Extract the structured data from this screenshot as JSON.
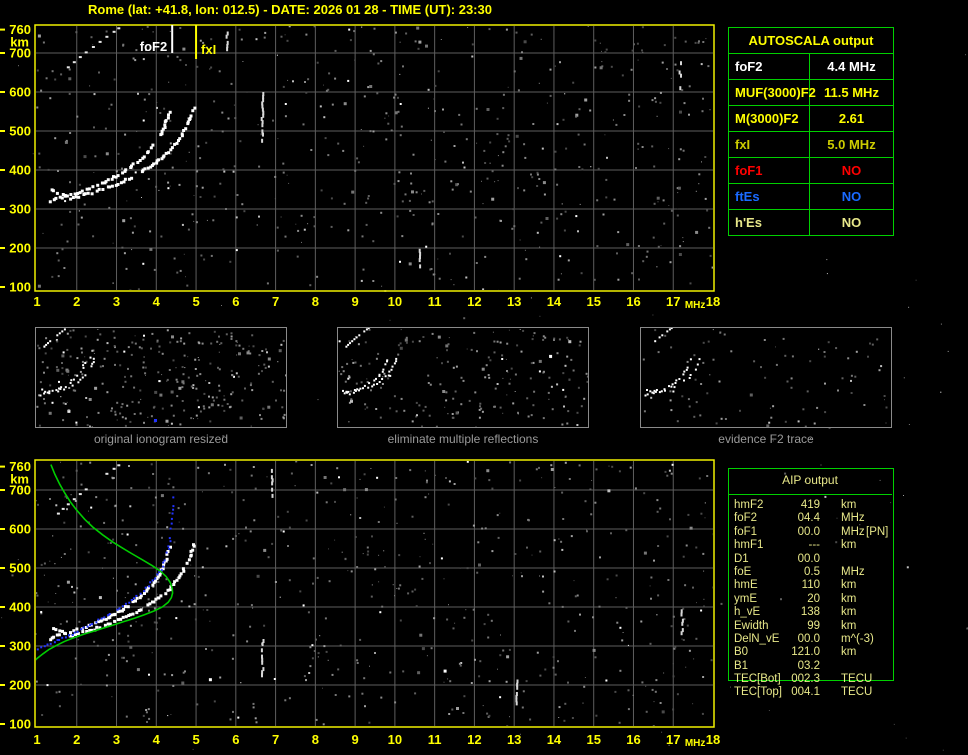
{
  "title": "Rome (lat: +41.8, lon: 012.5) - DATE: 2026 01 28 - TIME (UT): 23:30",
  "colors": {
    "axis_yellow": "#ffff00",
    "border_yellow": "#f0f000",
    "grid_gray": "#5e5e5e",
    "table_green": "#00d000",
    "khaki": "#e8e88a",
    "red": "#ff0000",
    "blue": "#1a6aff",
    "olive": "#cccc00",
    "white": "#ffffff",
    "caption_gray": "#9a9a9a",
    "trace_blue": "#2233ff",
    "profile_green": "#00cc00"
  },
  "autoscala_table": {
    "title": "AUTOSCALA output",
    "rows": [
      {
        "label": "foF2",
        "value": "4.4 MHz",
        "color": "#ffffff"
      },
      {
        "label": "MUF(3000)F2",
        "value": "11.5 MHz",
        "color": "#ffff00"
      },
      {
        "label": "M(3000)F2",
        "value": "2.61",
        "color": "#ffff00"
      },
      {
        "label": "fxI",
        "value": "5.0 MHz",
        "color": "#cccc00"
      },
      {
        "label": "foF1",
        "value": "NO",
        "color": "#ff0000"
      },
      {
        "label": "ftEs",
        "value": "NO",
        "color": "#1a6aff"
      },
      {
        "label": "h'Es",
        "value": "NO",
        "color": "#e8e88a"
      }
    ]
  },
  "aip_table": {
    "title": "AIP output",
    "rows": [
      {
        "label": "hmF2",
        "value": "419",
        "unit": "km",
        "note": ""
      },
      {
        "label": "foF2",
        "value": "04.4",
        "unit": "MHz",
        "note": ""
      },
      {
        "label": "foF1",
        "value": "00.0",
        "unit": "MHz",
        "note": "[PN]"
      },
      {
        "label": "hmF1",
        "value": "---",
        "unit": "km",
        "note": ""
      },
      {
        "label": "D1",
        "value": "00.0",
        "unit": "",
        "note": ""
      },
      {
        "label": "foE",
        "value": "0.5",
        "unit": "MHz",
        "note": ""
      },
      {
        "label": "hmE",
        "value": "110",
        "unit": "km",
        "note": ""
      },
      {
        "label": "ymE",
        "value": "20",
        "unit": "km",
        "note": ""
      },
      {
        "label": "h_vE",
        "value": "138",
        "unit": "km",
        "note": ""
      },
      {
        "label": "Ewidth",
        "value": "99",
        "unit": "km",
        "note": ""
      },
      {
        "label": "DelN_vE",
        "value": "00.0",
        "unit": "m^(-3)",
        "note": ""
      },
      {
        "label": "B0",
        "value": "121.0",
        "unit": "km",
        "note": ""
      },
      {
        "label": "B1",
        "value": "03.2",
        "unit": "",
        "note": ""
      },
      {
        "label": "TEC[Bot]",
        "value": "002.3",
        "unit": "TECU",
        "note": ""
      },
      {
        "label": "TEC[Top]",
        "value": "004.1",
        "unit": "TECU",
        "note": ""
      }
    ]
  },
  "thumbnails": [
    {
      "caption": "original ionogram resized",
      "noise_dots": 300,
      "has_blue_dot": true
    },
    {
      "caption": "eliminate multiple reflections",
      "noise_dots": 210,
      "has_blue_dot": false
    },
    {
      "caption": "evidence F2 trace",
      "noise_dots": 90,
      "has_blue_dot": false
    }
  ],
  "chart_data": [
    {
      "id": "top-ionogram",
      "type": "scatter",
      "title": "ionogram with AUTOSCALA scaling",
      "xlabel": "MHz",
      "ylabel": "km",
      "xlim": [
        1,
        18
      ],
      "ylim": [
        100,
        775
      ],
      "x_ticks": [
        1,
        2,
        3,
        4,
        5,
        6,
        7,
        8,
        9,
        10,
        11,
        12,
        13,
        14,
        15,
        16,
        17,
        18
      ],
      "y_ticks": [
        100,
        200,
        300,
        400,
        500,
        600,
        700
      ],
      "y_top_tick": 760,
      "grid": true,
      "markers": [
        {
          "label": "foF2",
          "freq": 4.4,
          "color": "#ffffff"
        },
        {
          "label": "fxI",
          "freq": 5.0,
          "color": "#ffff00"
        }
      ],
      "interference_columns": [
        {
          "freq": 5.75,
          "km_range": [
            715,
            762
          ]
        },
        {
          "freq": 6.65,
          "km_range": [
            480,
            600
          ]
        },
        {
          "freq": 10.6,
          "km_range": [
            150,
            200
          ]
        },
        {
          "freq": 17.15,
          "km_range": [
            615,
            685
          ]
        }
      ],
      "series": [
        {
          "name": "F2-trace-ordinary",
          "color": "#ffffff",
          "style": "trace",
          "points": [
            [
              1.3,
              322
            ],
            [
              1.45,
              330
            ],
            [
              1.6,
              334
            ],
            [
              1.75,
              338
            ],
            [
              1.9,
              343
            ],
            [
              2.05,
              348
            ],
            [
              2.2,
              353
            ],
            [
              2.35,
              359
            ],
            [
              2.5,
              365
            ],
            [
              2.65,
              372
            ],
            [
              2.8,
              379
            ],
            [
              2.95,
              387
            ],
            [
              3.1,
              396
            ],
            [
              3.25,
              406
            ],
            [
              3.4,
              417
            ],
            [
              3.55,
              429
            ],
            [
              3.7,
              442
            ],
            [
              3.82,
              456
            ],
            [
              3.93,
              471
            ],
            [
              4.03,
              487
            ],
            [
              4.12,
              504
            ],
            [
              4.19,
              521
            ],
            [
              4.25,
              538
            ],
            [
              4.3,
              553
            ],
            [
              4.34,
              566
            ]
          ]
        },
        {
          "name": "F2-trace-extraordinary",
          "color": "#ffffff",
          "style": "trace",
          "points": [
            [
              1.8,
              330
            ],
            [
              2.0,
              335
            ],
            [
              2.2,
              341
            ],
            [
              2.4,
              347
            ],
            [
              2.6,
              354
            ],
            [
              2.8,
              361
            ],
            [
              3.0,
              369
            ],
            [
              3.2,
              378
            ],
            [
              3.4,
              388
            ],
            [
              3.6,
              399
            ],
            [
              3.8,
              411
            ],
            [
              4.0,
              425
            ],
            [
              4.18,
              440
            ],
            [
              4.34,
              456
            ],
            [
              4.48,
              473
            ],
            [
              4.6,
              491
            ],
            [
              4.7,
              509
            ],
            [
              4.78,
              527
            ],
            [
              4.85,
              544
            ],
            [
              4.9,
              558
            ],
            [
              4.94,
              568
            ]
          ]
        },
        {
          "name": "trace-fork-spur",
          "color": "#ffffff",
          "style": "trace",
          "points": [
            [
              1.32,
              352
            ],
            [
              1.45,
              345
            ],
            [
              1.6,
              339
            ],
            [
              1.75,
              338
            ]
          ]
        },
        {
          "name": "multiple-reflection-streak",
          "color": "#e8e8e8",
          "style": "dashes",
          "points": [
            [
              1.5,
              642
            ],
            [
              1.62,
              654
            ],
            [
              1.75,
              666
            ],
            [
              1.9,
              679
            ],
            [
              2.05,
              692
            ],
            [
              2.2,
              704
            ],
            [
              2.38,
              718
            ],
            [
              2.55,
              731
            ],
            [
              2.72,
              744
            ],
            [
              2.9,
              757
            ],
            [
              3.02,
              766
            ]
          ]
        }
      ]
    },
    {
      "id": "bottom-profile-ionogram",
      "type": "line",
      "title": "ionogram with scaled trace and electron density profile (AIP)",
      "xlabel": "MHz",
      "ylabel": "km",
      "xlim": [
        1,
        18
      ],
      "ylim": [
        100,
        775
      ],
      "x_ticks": [
        1,
        2,
        3,
        4,
        5,
        6,
        7,
        8,
        9,
        10,
        11,
        12,
        13,
        14,
        15,
        16,
        17,
        18
      ],
      "y_ticks": [
        100,
        200,
        300,
        400,
        500,
        600,
        700
      ],
      "y_top_tick": 760,
      "grid": true,
      "background_series_from": "top-ionogram",
      "interference_columns": [
        {
          "freq": 6.65,
          "km_range": [
            230,
            330
          ]
        },
        {
          "freq": 6.9,
          "km_range": [
            690,
            760
          ]
        },
        {
          "freq": 13.05,
          "km_range": [
            150,
            215
          ]
        },
        {
          "freq": 17.2,
          "km_range": [
            330,
            400
          ]
        }
      ],
      "series": [
        {
          "name": "scaled-F2-trace",
          "color": "#2233ff",
          "style": "dots",
          "points": [
            [
              1.0,
              293
            ],
            [
              1.1,
              298
            ],
            [
              1.25,
              305
            ],
            [
              1.4,
              312
            ],
            [
              1.55,
              319
            ],
            [
              1.7,
              326
            ],
            [
              1.85,
              333
            ],
            [
              2.0,
              340
            ],
            [
              2.15,
              348
            ],
            [
              2.3,
              356
            ],
            [
              2.45,
              364
            ],
            [
              2.6,
              372
            ],
            [
              2.75,
              381
            ],
            [
              2.9,
              390
            ],
            [
              3.05,
              400
            ],
            [
              3.2,
              410
            ],
            [
              3.35,
              421
            ],
            [
              3.5,
              432
            ],
            [
              3.65,
              444
            ],
            [
              3.78,
              457
            ],
            [
              3.9,
              470
            ],
            [
              4.0,
              484
            ],
            [
              4.09,
              499
            ],
            [
              4.17,
              515
            ],
            [
              4.23,
              532
            ],
            [
              4.28,
              550
            ],
            [
              4.32,
              570
            ],
            [
              4.35,
              592
            ],
            [
              4.37,
              615
            ],
            [
              4.39,
              640
            ],
            [
              4.4,
              663
            ],
            [
              4.41,
              685
            ],
            [
              4.42,
              700
            ]
          ]
        },
        {
          "name": "electron-density-profile",
          "color": "#00cc00",
          "style": "line",
          "points": [
            [
              1.35,
              765
            ],
            [
              1.45,
              740
            ],
            [
              1.57,
              715
            ],
            [
              1.7,
              692
            ],
            [
              1.85,
              668
            ],
            [
              2.0,
              648
            ],
            [
              2.2,
              625
            ],
            [
              2.4,
              605
            ],
            [
              2.65,
              585
            ],
            [
              2.9,
              567
            ],
            [
              3.15,
              551
            ],
            [
              3.4,
              536
            ],
            [
              3.65,
              521
            ],
            [
              3.9,
              506
            ],
            [
              4.1,
              492
            ],
            [
              4.25,
              478
            ],
            [
              4.35,
              463
            ],
            [
              4.4,
              448
            ],
            [
              4.41,
              436
            ],
            [
              4.38,
              424
            ],
            [
              4.3,
              412
            ],
            [
              4.15,
              400
            ],
            [
              3.95,
              390
            ],
            [
              3.7,
              380
            ],
            [
              3.45,
              371
            ],
            [
              3.2,
              363
            ],
            [
              2.95,
              355
            ],
            [
              2.7,
              347
            ],
            [
              2.45,
              339
            ],
            [
              2.2,
              331
            ],
            [
              1.95,
              322
            ],
            [
              1.7,
              312
            ],
            [
              1.5,
              302
            ],
            [
              1.3,
              291
            ],
            [
              1.15,
              280
            ],
            [
              1.0,
              268
            ],
            [
              0.92,
              260
            ]
          ]
        }
      ]
    }
  ]
}
